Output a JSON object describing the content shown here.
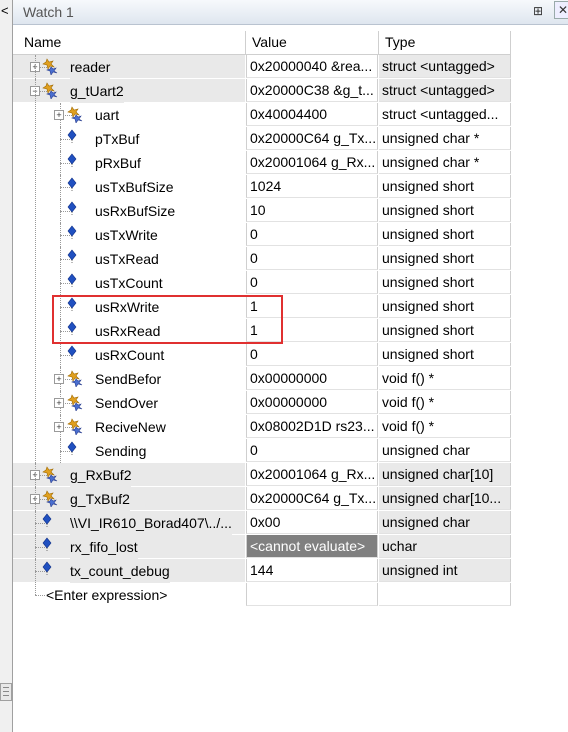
{
  "window": {
    "title": "Watch 1",
    "pin_glyph": "⊞",
    "close_glyph": "✕"
  },
  "leftstrip": {
    "arrow": "<"
  },
  "columns": {
    "name": "Name",
    "value": "Value",
    "type": "Type"
  },
  "rows": [
    {
      "name": "reader",
      "value": "0x20000040 &rea...",
      "type": "struct <untagged>",
      "level": 0,
      "expander": "+",
      "icon": "struct-icon",
      "gray": true
    },
    {
      "name": "g_tUart2",
      "value": "0x20000C38 &g_t...",
      "type": "struct <untagged>",
      "level": 0,
      "expander": "-",
      "icon": "struct-icon",
      "gray": true
    },
    {
      "name": "uart",
      "value": "0x40004400",
      "type": "struct <untagged...",
      "level": 1,
      "expander": "+",
      "icon": "struct-icon"
    },
    {
      "name": "pTxBuf",
      "value": "0x20000C64 g_Tx...",
      "type": "unsigned char *",
      "level": 1,
      "icon": "variable-icon"
    },
    {
      "name": "pRxBuf",
      "value": "0x20001064 g_Rx...",
      "type": "unsigned char *",
      "level": 1,
      "icon": "variable-icon"
    },
    {
      "name": "usTxBufSize",
      "value": "1024",
      "type": "unsigned short",
      "level": 1,
      "icon": "variable-icon"
    },
    {
      "name": "usRxBufSize",
      "value": "10",
      "type": "unsigned short",
      "level": 1,
      "icon": "variable-icon"
    },
    {
      "name": "usTxWrite",
      "value": "0",
      "type": "unsigned short",
      "level": 1,
      "icon": "variable-icon"
    },
    {
      "name": "usTxRead",
      "value": "0",
      "type": "unsigned short",
      "level": 1,
      "icon": "variable-icon"
    },
    {
      "name": "usTxCount",
      "value": "0",
      "type": "unsigned short",
      "level": 1,
      "icon": "variable-icon"
    },
    {
      "name": "usRxWrite",
      "value": "1",
      "type": "unsigned short",
      "level": 1,
      "icon": "variable-icon"
    },
    {
      "name": "usRxRead",
      "value": "1",
      "type": "unsigned short",
      "level": 1,
      "icon": "variable-icon"
    },
    {
      "name": "usRxCount",
      "value": "0",
      "type": "unsigned short",
      "level": 1,
      "icon": "variable-icon"
    },
    {
      "name": "SendBefor",
      "value": "0x00000000",
      "type": "void f()  *",
      "level": 1,
      "expander": "+",
      "icon": "struct-icon"
    },
    {
      "name": "SendOver",
      "value": "0x00000000",
      "type": "void f()  *",
      "level": 1,
      "expander": "+",
      "icon": "struct-icon"
    },
    {
      "name": "ReciveNew",
      "value": "0x08002D1D rs23...",
      "type": "void f()  *",
      "level": 1,
      "expander": "+",
      "icon": "struct-icon"
    },
    {
      "name": "Sending",
      "value": "0",
      "type": "unsigned char",
      "level": 1,
      "icon": "variable-icon"
    },
    {
      "name": "g_RxBuf2",
      "value": "0x20001064 g_Rx...",
      "type": "unsigned char[10]",
      "level": 0,
      "expander": "+",
      "icon": "struct-icon",
      "gray": true
    },
    {
      "name": "g_TxBuf2",
      "value": "0x20000C64 g_Tx...",
      "type": "unsigned char[10...",
      "level": 0,
      "expander": "+",
      "icon": "struct-icon",
      "gray": true
    },
    {
      "name": "\\\\VI_IR610_Borad407\\../...",
      "value": "0x00",
      "type": "unsigned char",
      "level": 0,
      "icon": "variable-icon",
      "gray": true
    },
    {
      "name": "rx_fifo_lost",
      "value": "<cannot evaluate>",
      "type": "uchar",
      "level": 0,
      "icon": "variable-icon",
      "gray": true,
      "noeval": true
    },
    {
      "name": "tx_count_debug",
      "value": "144",
      "type": "unsigned int",
      "level": 0,
      "icon": "variable-icon",
      "gray": true
    }
  ],
  "enter_expression": "<Enter expression>",
  "colors": {
    "highlight_box": "#e03030",
    "cannot_evaluate_bg": "#808080",
    "row_gray": "#e9e9e9"
  }
}
